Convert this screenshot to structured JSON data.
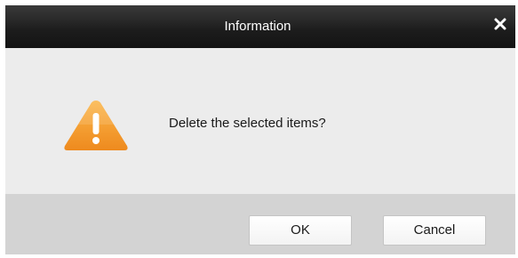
{
  "dialog": {
    "title": "Information",
    "message": "Delete the selected items?",
    "icon": "warning-icon",
    "close_icon": "close-icon",
    "buttons": {
      "ok_label": "OK",
      "cancel_label": "Cancel"
    },
    "colors": {
      "titlebar": "#1c1c1c",
      "body": "#ececec",
      "footer": "#d3d3d3",
      "warning": "#f39a2b"
    }
  }
}
